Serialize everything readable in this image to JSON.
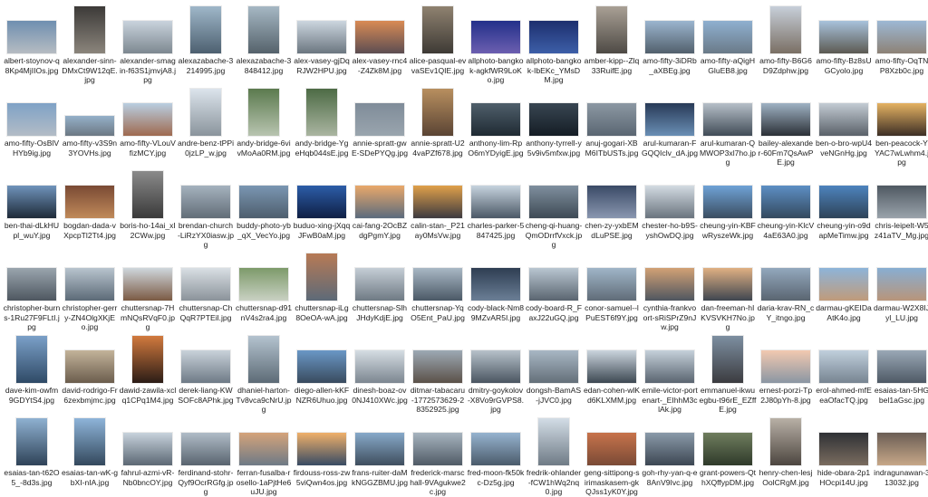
{
  "files": [
    {
      "name": "albert-stoynov-q8Kp4MjIIOs.jpg",
      "shape": "land",
      "c1": "#6f8fb0",
      "c2": "#b6bcc2"
    },
    {
      "name": "alexander-sinn-DMxCt9W12qE.jpg",
      "shape": "port",
      "c1": "#3c3a38",
      "c2": "#8b857c"
    },
    {
      "name": "alexander-smagin-f63S1jmvjA8.jpg",
      "shape": "land",
      "c1": "#c9d3dd",
      "c2": "#7d8890"
    },
    {
      "name": "alexazabache-3214995.jpg",
      "shape": "port",
      "c1": "#9fb7c9",
      "c2": "#4d6070"
    },
    {
      "name": "alexazabache-3848412.jpg",
      "shape": "port",
      "c1": "#a6b8c4",
      "c2": "#55626b"
    },
    {
      "name": "alex-vasey-gjDqRJW2HPU.jpg",
      "shape": "land",
      "c1": "#ccd6df",
      "c2": "#6b7680"
    },
    {
      "name": "alex-vasey-rnc4-Z4Zk8M.jpg",
      "shape": "land",
      "c1": "#d98b55",
      "c2": "#5c4d52"
    },
    {
      "name": "alice-pasqual-evvaSEv1QIE.jpg",
      "shape": "port",
      "c1": "#8f8270",
      "c2": "#3e3a35"
    },
    {
      "name": "allphoto-bangkok-agkfWR9LoKo.jpg",
      "shape": "land",
      "c1": "#23308a",
      "c2": "#6c5fb0"
    },
    {
      "name": "allphoto-bangkok-IbEKc_YMsDM.jpg",
      "shape": "land",
      "c1": "#1d2f6e",
      "c2": "#3d5fa8"
    },
    {
      "name": "amber-kipp--Zlq33RuifE.jpg",
      "shape": "port",
      "c1": "#a9a095",
      "c2": "#4e4a45"
    },
    {
      "name": "amo-fifty-3iDRb_aXBEg.jpg",
      "shape": "land",
      "c1": "#9bb5cf",
      "c2": "#52606c"
    },
    {
      "name": "amo-fifty-aQigHGluEB8.jpg",
      "shape": "land",
      "c1": "#8fb0d0",
      "c2": "#6a7a88"
    },
    {
      "name": "amo-fifty-B6G6D9Zdphw.jpg",
      "shape": "port",
      "c1": "#c7cfd9",
      "c2": "#7a6f64"
    },
    {
      "name": "amo-fifty-Bz8sUGCyolo.jpg",
      "shape": "land",
      "c1": "#a8c2dc",
      "c2": "#5c5a52"
    },
    {
      "name": "amo-fifty-OqTNP8Xzb0c.jpg",
      "shape": "land",
      "c1": "#9db8d4",
      "c2": "#8d8276"
    },
    {
      "name": "amo-fifty-OsBlVHYb9ig.jpg",
      "shape": "land",
      "c1": "#7fa2c6",
      "c2": "#b3bcc6"
    },
    {
      "name": "amo-fifty-v3S9n3YOVHs.jpg",
      "shape": "small",
      "c1": "#95b0c9",
      "c2": "#6c7883"
    },
    {
      "name": "amo-fifty-VLouVfizMCY.jpg",
      "shape": "land",
      "c1": "#b9cee1",
      "c2": "#9f6a50"
    },
    {
      "name": "andre-benz-tPPi0jzLP_w.jpg",
      "shape": "port",
      "c1": "#dce4ec",
      "c2": "#8a949c"
    },
    {
      "name": "andy-bridge-6vivMoAa0RM.jpg",
      "shape": "port",
      "c1": "#5b7a4e",
      "c2": "#b8c4b0"
    },
    {
      "name": "andy-bridge-YgeHqb044sE.jpg",
      "shape": "port",
      "c1": "#4d6b45",
      "c2": "#aab5a1"
    },
    {
      "name": "annie-spratt-gwE-SDePYQg.jpg",
      "shape": "land",
      "c1": "#7f8c99",
      "c2": "#9aa5ae"
    },
    {
      "name": "annie-spratt-U24vaPZf678.jpg",
      "shape": "port",
      "c1": "#b88f5f",
      "c2": "#5a4434"
    },
    {
      "name": "anthony-lim-RpO6mYDyigE.jpg",
      "shape": "land",
      "c1": "#4f5f6b",
      "c2": "#1f2a33"
    },
    {
      "name": "anthony-tyrrell-y5v9iv5mfxw.jpg",
      "shape": "land",
      "c1": "#394652",
      "c2": "#151d25"
    },
    {
      "name": "anuj-gogari-XBM6ITbUSTs.jpg",
      "shape": "land",
      "c1": "#8c98a3",
      "c2": "#5a6672"
    },
    {
      "name": "arul-kumaran-FGQQIclv_dA.jpg",
      "shape": "land",
      "c1": "#283a57",
      "c2": "#6a8fb5"
    },
    {
      "name": "arul-kumaran-QMWOP3xl7ho.jpg",
      "shape": "land",
      "c1": "#b6bfc8",
      "c2": "#414c57"
    },
    {
      "name": "bailey-alexander-60Fm7QsAwPE.jpg",
      "shape": "land",
      "c1": "#9fb2c4",
      "c2": "#2b3036"
    },
    {
      "name": "ben-o-bro-wpU4veNGnHg.jpg",
      "shape": "land",
      "c1": "#c3cbd3",
      "c2": "#5a6169"
    },
    {
      "name": "ben-peacock-YYAC7wLwhm4.jpg",
      "shape": "land",
      "c1": "#e5b262",
      "c2": "#3d2f26"
    },
    {
      "name": "ben-thai-dLkHUpl_wuY.jpg",
      "shape": "land",
      "c1": "#6f93bb",
      "c2": "#1e2a38"
    },
    {
      "name": "bogdan-dada-vXpcpTl2Tt4.jpg",
      "shape": "land",
      "c1": "#7a4a34",
      "c2": "#c08a5a"
    },
    {
      "name": "boris-ho-14ai_xI2CWw.jpg",
      "shape": "port",
      "c1": "#8a8a8a",
      "c2": "#3a3a3a"
    },
    {
      "name": "brendan-church-LiRzYX0iasw.jpg",
      "shape": "land",
      "c1": "#a5b2be",
      "c2": "#626d77"
    },
    {
      "name": "buddy-photo-yb_qX_VecYo.jpg",
      "shape": "land",
      "c1": "#7a96b2",
      "c2": "#4e5e6d"
    },
    {
      "name": "buduo-xing-jXqqJFwB0aM.jpg",
      "shape": "land",
      "c1": "#2c5da8",
      "c2": "#0f1f44"
    },
    {
      "name": "cai-fang-2OcBZdgPgmY.jpg",
      "shape": "land",
      "c1": "#e9a86a",
      "c2": "#5b6b7d"
    },
    {
      "name": "calin-stan-_P21ay0MsVw.jpg",
      "shape": "land",
      "c1": "#e0a04a",
      "c2": "#3d3a40"
    },
    {
      "name": "charles-parker-5847425.jpg",
      "shape": "land",
      "c1": "#c6d3de",
      "c2": "#4b5866"
    },
    {
      "name": "cheng-qi-huang-QmODrrfVxck.jpg",
      "shape": "land",
      "c1": "#7f8f9e",
      "c2": "#3e4a55"
    },
    {
      "name": "chen-zy-yxbEMdLuPSE.jpg",
      "shape": "land",
      "c1": "#3a4a66",
      "c2": "#8a97b0"
    },
    {
      "name": "chester-ho-b9S-yshOwDQ.jpg",
      "shape": "land",
      "c1": "#d3dbe2",
      "c2": "#6a747e"
    },
    {
      "name": "cheung-yin-KBFwRyszeWk.jpg",
      "shape": "land",
      "c1": "#6fa2d6",
      "c2": "#3b4d60"
    },
    {
      "name": "cheung-yin-KlcV4aE63A0.jpg",
      "shape": "land",
      "c1": "#5d8fc4",
      "c2": "#34495e"
    },
    {
      "name": "cheung-yin-o9dapMeTimw.jpg",
      "shape": "land",
      "c1": "#4d83bd",
      "c2": "#2e4358"
    },
    {
      "name": "chris-leipelt-W5z41aTV_Mg.jpg",
      "shape": "land",
      "c1": "#4f5962",
      "c2": "#9aa3ab"
    },
    {
      "name": "christopher-burns-1Ru27F9FLtI.jpg",
      "shape": "land",
      "c1": "#9aa5ae",
      "c2": "#4e5760"
    },
    {
      "name": "christopher-gerry-ZN4OlgXKjEo.jpg",
      "shape": "land",
      "c1": "#b8c4ce",
      "c2": "#5c6a77"
    },
    {
      "name": "chuttersnap-7HmNQsRVqF0.jpg",
      "shape": "land",
      "c1": "#cfd7dd",
      "c2": "#7b5a44"
    },
    {
      "name": "chuttersnap-ChQqR7PTEil.jpg",
      "shape": "land",
      "c1": "#d9dfe4",
      "c2": "#8b939a"
    },
    {
      "name": "chuttersnap-d91nV4s2ra4.jpg",
      "shape": "land",
      "c1": "#7d9a6a",
      "c2": "#c9d1c3"
    },
    {
      "name": "chuttersnap-iLg8OeOA-wA.jpg",
      "shape": "port",
      "c1": "#b77a55",
      "c2": "#5d6a78"
    },
    {
      "name": "chuttersnap-SlhJHdyKdjE.jpg",
      "shape": "land",
      "c1": "#c5ced6",
      "c2": "#6f7a84"
    },
    {
      "name": "chuttersnap-YqO5Ent_PaU.jpg",
      "shape": "land",
      "c1": "#a9b8c5",
      "c2": "#4b5966"
    },
    {
      "name": "cody-black-Nm89MZvAR5I.jpg",
      "shape": "land",
      "c1": "#2e3d52",
      "c2": "#6b7f96"
    },
    {
      "name": "cody-board-R_FaxJ22uGQ.jpg",
      "shape": "land",
      "c1": "#b9c6d1",
      "c2": "#5a6570"
    },
    {
      "name": "conor-samuel--lPuEST6f9Y.jpg",
      "shape": "land",
      "c1": "#a0b5c8",
      "c2": "#606c78"
    },
    {
      "name": "cynthia-frankvoort-sRiSPrZ9nJw.jpg",
      "shape": "land",
      "c1": "#d2a175",
      "c2": "#4f5660"
    },
    {
      "name": "dan-freeman-hIKVSVKH7No.jpg",
      "shape": "land",
      "c1": "#e0b083",
      "c2": "#3f4650"
    },
    {
      "name": "daria-krav-RN_cY_itngo.jpg",
      "shape": "land",
      "c1": "#93a8bd",
      "c2": "#5a6571"
    },
    {
      "name": "darmau-gKEIDaAtK4o.jpg",
      "shape": "land",
      "c1": "#8db4d9",
      "c2": "#c09b7a"
    },
    {
      "name": "darmau-W2X8IJyl_LU.jpg",
      "shape": "land",
      "c1": "#88aed2",
      "c2": "#b8957a"
    },
    {
      "name": "dave-kim-owfm9GDYtS4.jpg",
      "shape": "port",
      "c1": "#7ba0c8",
      "c2": "#2f4a66"
    },
    {
      "name": "david-rodrigo-Fr6zexbmjmc.jpg",
      "shape": "land",
      "c1": "#c3b39a",
      "c2": "#6b5d4d"
    },
    {
      "name": "dawid-zawila-xclq1CPq1M4.jpg",
      "shape": "port",
      "c1": "#d27a3e",
      "c2": "#2b1c16"
    },
    {
      "name": "derek-liang-KWSOFc8APhk.jpg",
      "shape": "land",
      "c1": "#c9d2da",
      "c2": "#6e7a86"
    },
    {
      "name": "dhaniel-harton-Tv8vca9cNrU.jpg",
      "shape": "port",
      "c1": "#b4c3cf",
      "c2": "#5d6b76"
    },
    {
      "name": "diego-allen-kKFNZR6Uhuo.jpg",
      "shape": "land",
      "c1": "#6a97c6",
      "c2": "#394b5e"
    },
    {
      "name": "dinesh-boaz-ov0NJ410XWc.jpg",
      "shape": "land",
      "c1": "#d5dde3",
      "c2": "#7c8690"
    },
    {
      "name": "ditmar-tabacaru-1772573629-28352925.jpg",
      "shape": "land",
      "c1": "#9da9b4",
      "c2": "#5b5148"
    },
    {
      "name": "dmitry-goykolov-X8Vo9rGVPS8.jpg",
      "shape": "land",
      "c1": "#b7c1ca",
      "c2": "#4a5561"
    },
    {
      "name": "dongsh-BamAS-jJVC0.jpg",
      "shape": "land",
      "c1": "#a8b7c4",
      "c2": "#646f79"
    },
    {
      "name": "edan-cohen-wlKd6KLXMM.jpg",
      "shape": "land",
      "c1": "#cbd5de",
      "c2": "#3d4852"
    },
    {
      "name": "emile-victor-portenart-_EIhhM3clAk.jpg",
      "shape": "land",
      "c1": "#c5d0da",
      "c2": "#5a6470"
    },
    {
      "name": "emmanuel-ikwuegbu-t96rE_EZffE.jpg",
      "shape": "port",
      "c1": "#7d8fa1",
      "c2": "#3b3b3f"
    },
    {
      "name": "ernest-porzi-Tp2J80pYh-8.jpg",
      "shape": "land",
      "c1": "#f2c9b0",
      "c2": "#8a96a3"
    },
    {
      "name": "erol-ahmed-mfEeaOfacTQ.jpg",
      "shape": "land",
      "c1": "#c0cfdc",
      "c2": "#778491"
    },
    {
      "name": "esaias-tan-5HGbel1aGsc.jpg",
      "shape": "land",
      "c1": "#9aa8b6",
      "c2": "#4e5965"
    },
    {
      "name": "esaias-tan-t62O5_-8d3s.jpg",
      "shape": "port",
      "c1": "#8fb1d1",
      "c2": "#2f4358"
    },
    {
      "name": "esaias-tan-wK-gbXI-nIA.jpg",
      "shape": "port",
      "c1": "#8eb4d9",
      "c2": "#34495d"
    },
    {
      "name": "fahrul-azmi-vR-Nb0bncOY.jpg",
      "shape": "land",
      "c1": "#c7d2dc",
      "c2": "#5c6874"
    },
    {
      "name": "ferdinand-stohr-Qyf9OcrRGfg.jpg",
      "shape": "land",
      "c1": "#b0bcc7",
      "c2": "#59646f"
    },
    {
      "name": "ferran-fusalba-rosello-1aPjtHe6uJU.jpg",
      "shape": "land",
      "c1": "#d4a37a",
      "c2": "#6e7a86"
    },
    {
      "name": "firdouss-ross-zw5viQwn4os.jpg",
      "shape": "land",
      "c1": "#f0b06a",
      "c2": "#384b64"
    },
    {
      "name": "frans-ruiter-daMkNGGZBMU.jpg",
      "shape": "land",
      "c1": "#87a9c9",
      "c2": "#3f4e5e"
    },
    {
      "name": "frederick-marschall-9VAgukwe2c.jpg",
      "shape": "land",
      "c1": "#a7b4bf",
      "c2": "#505b66"
    },
    {
      "name": "fred-moon-fk50kc-Dz5g.jpg",
      "shape": "land",
      "c1": "#96b3cf",
      "c2": "#4b5b6b"
    },
    {
      "name": "fredrik-ohlander-fCW1hWq2nq0.jpg",
      "shape": "port",
      "c1": "#d3dde6",
      "c2": "#6f7b86"
    },
    {
      "name": "geng-sittipong-sirimaskasem-gkQJss1yK0Y.jpg",
      "shape": "land",
      "c1": "#c7734b",
      "c2": "#7a4a36"
    },
    {
      "name": "goh-rhy-yan-q-e8AnV9Ivc.jpg",
      "shape": "land",
      "c1": "#8a9aa9",
      "c2": "#3d4753"
    },
    {
      "name": "grant-powers-QthXQffypDM.jpg",
      "shape": "land",
      "c1": "#6f7d5e",
      "c2": "#2f3a2a"
    },
    {
      "name": "henry-chen-lesjOolCRgM.jpg",
      "shape": "port",
      "c1": "#b8b0a6",
      "c2": "#4d4640"
    },
    {
      "name": "hide-obara-2p1HOcpi14U.jpg",
      "shape": "land",
      "c1": "#2f3135",
      "c2": "#7a6c5f"
    },
    {
      "name": "indragunawan-313032.jpg",
      "shape": "land",
      "c1": "#6b5e55",
      "c2": "#c7a788"
    }
  ]
}
